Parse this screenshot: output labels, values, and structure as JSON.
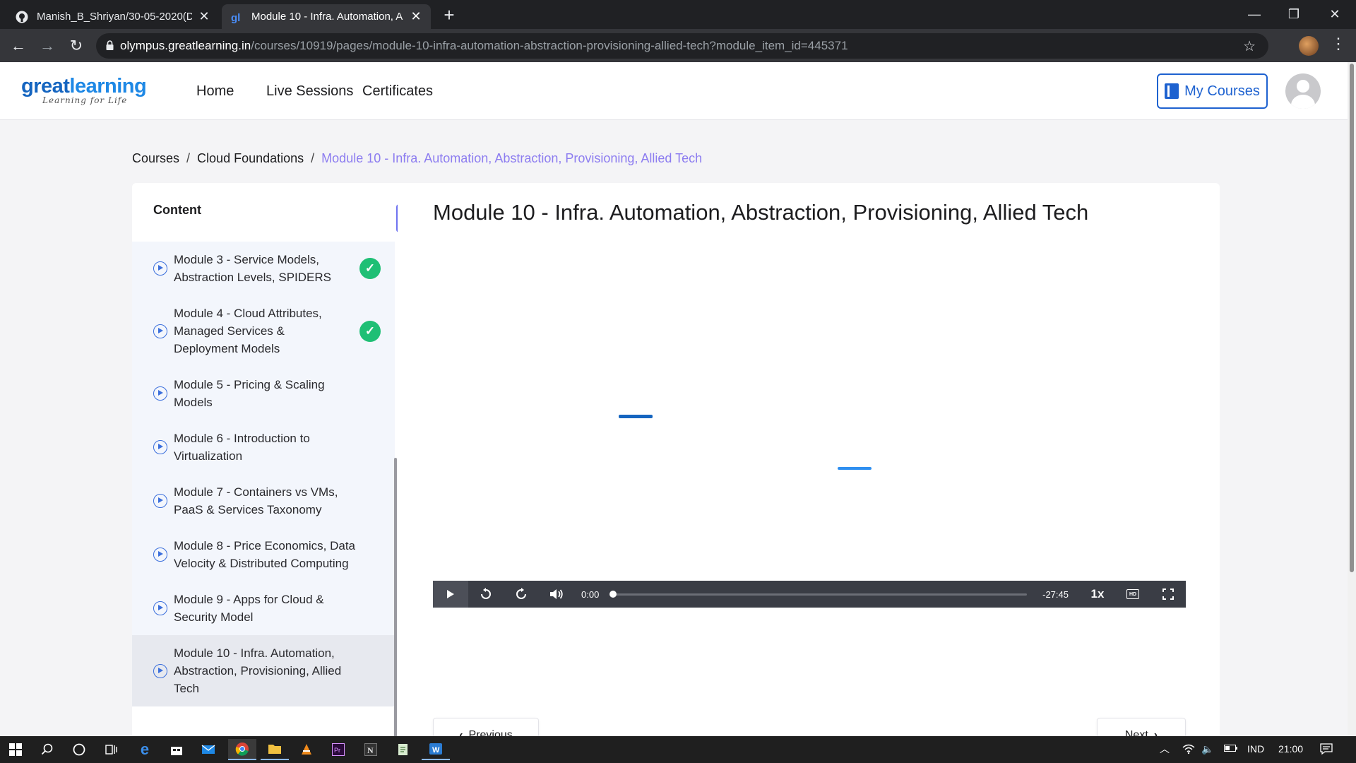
{
  "browser": {
    "tabs": [
      {
        "title": "Manish_B_Shriyan/30-05-2020(D",
        "active": false,
        "icon": "github-icon"
      },
      {
        "title": "Module 10 - Infra. Automation, A",
        "active": true,
        "icon": "greatlearning-favicon"
      }
    ],
    "new_tab": "+",
    "url_host": "olympus.greatlearning.in",
    "url_path": "/courses/10919/pages/module-10-infra-automation-abstraction-provisioning-allied-tech?module_item_id=445371"
  },
  "site": {
    "logo_text_a": "great",
    "logo_text_b": "learning",
    "logo_tagline": "Learning for Life",
    "nav": [
      "Home",
      "Live Sessions",
      "Certificates"
    ],
    "my_courses": "My Courses"
  },
  "breadcrumb": {
    "items": [
      "Courses",
      "Cloud Foundations"
    ],
    "separator": "/",
    "current": "Module 10 - Infra. Automation, Abstraction, Provisioning, Allied Tech"
  },
  "sidebar": {
    "heading": "Content",
    "collapse_glyph": "«",
    "modules": [
      {
        "label": "Module 3 - Service Models, Abstraction Levels, SPIDERS",
        "completed": true
      },
      {
        "label": "Module 4 - Cloud Attributes, Managed Services & Deployment Models",
        "completed": true
      },
      {
        "label": "Module 5 - Pricing & Scaling Models",
        "completed": false
      },
      {
        "label": "Module 6 - Introduction to Virtualization",
        "completed": false
      },
      {
        "label": "Module 7 - Containers vs VMs, PaaS & Services Taxonomy",
        "completed": false
      },
      {
        "label": "Module 8 - Price Economics, Data Velocity & Distributed Computing",
        "completed": false
      },
      {
        "label": "Module 9 - Apps for Cloud & Security Model",
        "completed": false
      },
      {
        "label": "Module 10 - Infra. Automation, Abstraction, Provisioning, Allied Tech",
        "completed": false,
        "active": true
      }
    ]
  },
  "main": {
    "title": "Module 10 - Infra. Automation, Abstraction, Provisioning, Allied Tech",
    "player": {
      "current_time": "0:00",
      "remaining_time": "-27:45",
      "playback_rate": "1x",
      "progress": 0,
      "hd_label": "HD"
    },
    "prev_label": "Previous",
    "next_label": "Next"
  },
  "taskbar": {
    "language": "IND",
    "clock": "21:00"
  },
  "colors": {
    "accent": "#1e62d0",
    "breadcrumb_current": "#8c7cf0",
    "complete_badge": "#1fbf75",
    "collapse_button": "#6f73f0"
  }
}
